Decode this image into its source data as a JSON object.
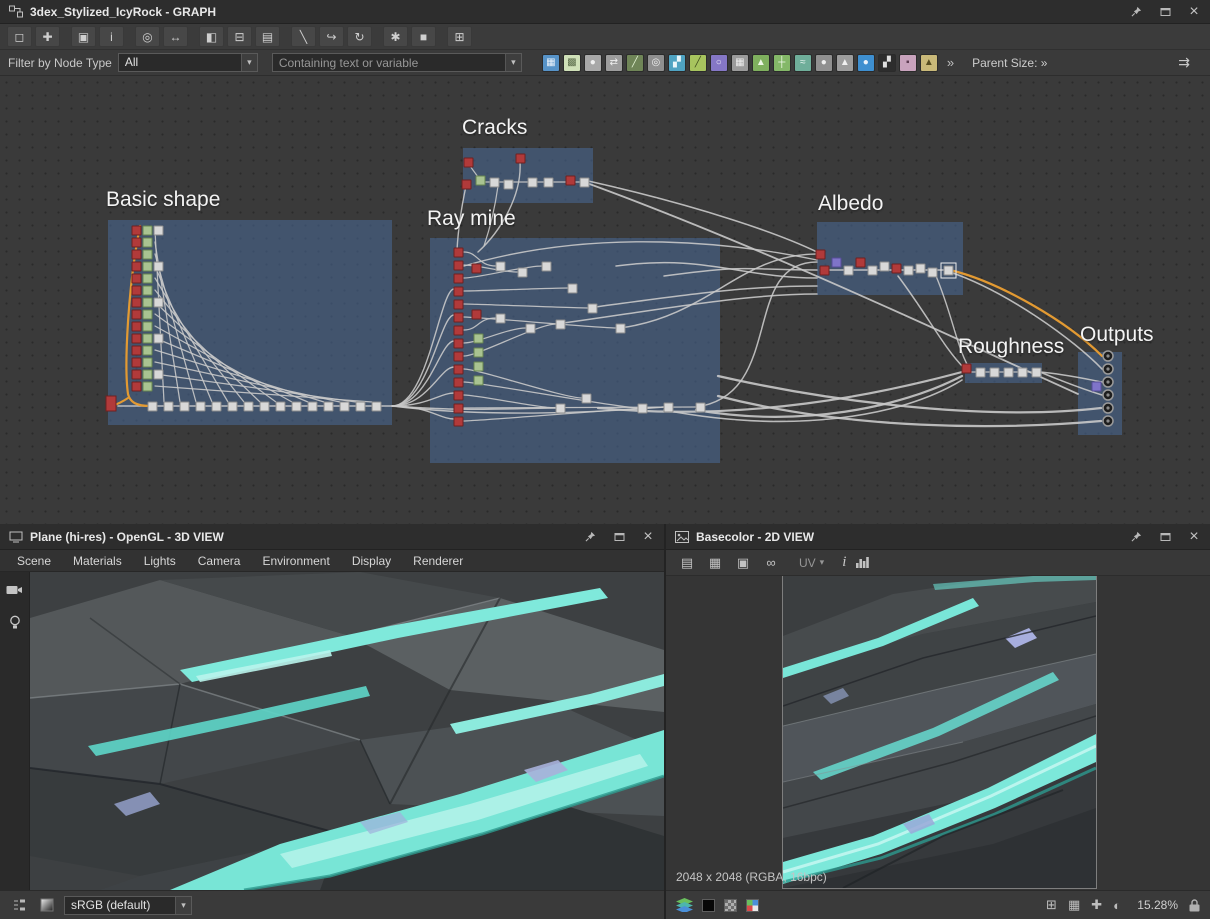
{
  "icons": {
    "close": "×",
    "chevron_down": "▾",
    "connectors": "⇉"
  },
  "graph": {
    "title": "3dex_Stylized_IcyRock - GRAPH",
    "toolbar": [
      {
        "name": "select-tool-icon",
        "glyph": "◻"
      },
      {
        "name": "pan-tool-icon",
        "glyph": "✚"
      },
      {
        "name": "screenshot-icon",
        "glyph": "▣"
      },
      {
        "name": "info-icon",
        "glyph": "i"
      },
      {
        "name": "zoom-icon",
        "glyph": "◎"
      },
      {
        "name": "resize-icon",
        "glyph": "↔"
      },
      {
        "name": "link-mode-icon",
        "glyph": "◧"
      },
      {
        "name": "unlink-icon",
        "glyph": "⊟"
      },
      {
        "name": "display-options-icon",
        "glyph": "▤"
      },
      {
        "name": "straight-links-icon",
        "glyph": "╲"
      },
      {
        "name": "curved-links-icon",
        "glyph": "↪"
      },
      {
        "name": "rotate-view-icon",
        "glyph": "↻"
      },
      {
        "name": "tools-icon",
        "glyph": "✱"
      },
      {
        "name": "frame-selection-icon",
        "glyph": "■"
      },
      {
        "name": "grid-snap-icon",
        "glyph": "⊞"
      }
    ],
    "filter": {
      "label": "Filter by Node Type",
      "type_value": "All",
      "search_placeholder": "Containing text or variable",
      "parent_size_label": "Parent Size: »",
      "more_glyph": "»"
    },
    "palette": [
      {
        "name": "bitmap-node-icon",
        "color": "#5793c8",
        "glyph": "▦",
        "fg": "#eaf2fa"
      },
      {
        "name": "svg-node-icon",
        "color": "#cfe0b8",
        "glyph": "▩",
        "fg": "#5a6b4a"
      },
      {
        "name": "blend-node-icon",
        "color": "#a8a8a8",
        "glyph": "●",
        "fg": "#efefef"
      },
      {
        "name": "shuffle-node-icon",
        "color": "#9d9d9d",
        "glyph": "⇄",
        "fg": "#f0f0f0"
      },
      {
        "name": "slope-blur-node-icon",
        "color": "#6f8557",
        "glyph": "╱",
        "fg": "#dff0d0"
      },
      {
        "name": "sphere-node-icon",
        "color": "#8f8f8f",
        "glyph": "◎",
        "fg": "#f2f2f2"
      },
      {
        "name": "gradient-map-node-icon",
        "color": "#4fa3c2",
        "glyph": "▞",
        "fg": "#eaf6fa"
      },
      {
        "name": "warp-node-icon",
        "color": "#a7c45e",
        "glyph": "╱",
        "fg": "#41501e"
      },
      {
        "name": "hsl-node-icon",
        "color": "#8577c6",
        "glyph": "○",
        "fg": "#efecfa"
      },
      {
        "name": "levels-node-icon",
        "color": "#9b9b9b",
        "glyph": "▦",
        "fg": "#ededed"
      },
      {
        "name": "curve-node-icon",
        "color": "#7fb05e",
        "glyph": "▲",
        "fg": "#ecf6e4"
      },
      {
        "name": "sharpen-node-icon",
        "color": "#84b868",
        "glyph": "┼",
        "fg": "#f0f8ea"
      },
      {
        "name": "emboss-node-icon",
        "color": "#6fae9a",
        "glyph": "≈",
        "fg": "#e8f5f0"
      },
      {
        "name": "normal-node-icon",
        "color": "#909090",
        "glyph": "●",
        "fg": "#efefef"
      },
      {
        "name": "height-node-icon",
        "color": "#9d9d9d",
        "glyph": "▲",
        "fg": "#f0f0f0"
      },
      {
        "name": "uniform-color-node-icon",
        "color": "#3e8fd0",
        "glyph": "●",
        "fg": "#eaf2fb"
      },
      {
        "name": "pixel-processor-node-icon",
        "color": "#2d2d2d",
        "glyph": "▞",
        "fg": "#e0e0e0"
      },
      {
        "name": "text-node-icon",
        "color": "#c9a3bd",
        "glyph": "▪",
        "fg": "#5d3c52"
      },
      {
        "name": "warning-node-icon",
        "color": "#c9b979",
        "glyph": "▲",
        "fg": "#564d22"
      }
    ],
    "groups": [
      {
        "label": "Basic shape"
      },
      {
        "label": "Cracks"
      },
      {
        "label": "Ray mine"
      },
      {
        "label": "Albedo"
      },
      {
        "label": "Roughness"
      },
      {
        "label": "Outputs"
      }
    ]
  },
  "view3d": {
    "title": "Plane (hi-res) - OpenGL - 3D VIEW",
    "menus": [
      "Scene",
      "Materials",
      "Lights",
      "Camera",
      "Environment",
      "Display",
      "Renderer"
    ],
    "colorspace_value": "sRGB (default)"
  },
  "view2d": {
    "title": "Basecolor - 2D VIEW",
    "toolbar": [
      {
        "name": "export-image-icon",
        "glyph": "▤"
      },
      {
        "name": "save-image-icon",
        "glyph": "▦"
      },
      {
        "name": "copy-image-icon",
        "glyph": "▣"
      },
      {
        "name": "link-view-icon",
        "glyph": "∞"
      }
    ],
    "uv_label": "UV",
    "info_glyph": "i",
    "resolution": "2048 x 2048 (RGBA, 16bpc)",
    "zoom_value": "15.28%",
    "footer_icons": [
      {
        "name": "pixel-grid-icon",
        "glyph": "⊞"
      },
      {
        "name": "tiling-icon",
        "glyph": "▦"
      },
      {
        "name": "pan-view-icon",
        "glyph": "✚"
      },
      {
        "name": "color-profile-icon",
        "glyph": "◐"
      }
    ]
  }
}
